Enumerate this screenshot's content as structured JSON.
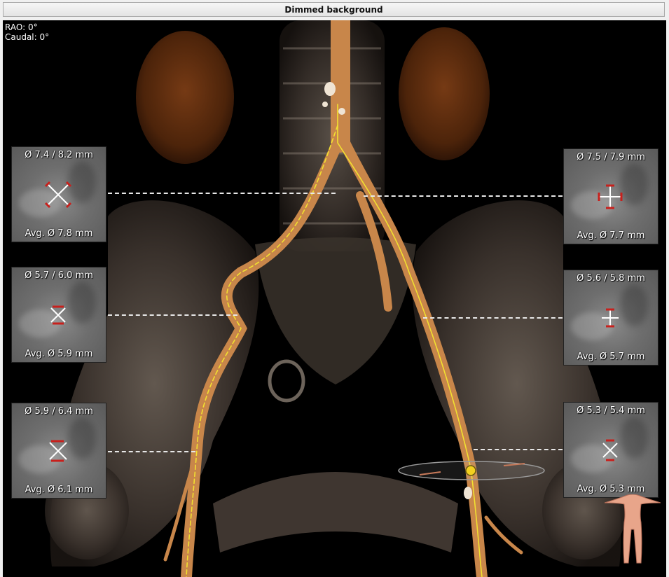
{
  "window": {
    "title": "Dimmed background"
  },
  "overlay": {
    "rao": "RAO: 0°",
    "caudal": "Caudal: 0°"
  },
  "panels": {
    "left": [
      {
        "top": "Ø 7.4 / 8.2 mm",
        "bottom": "Avg. Ø 7.8 mm"
      },
      {
        "top": "Ø 5.7 / 6.0 mm",
        "bottom": "Avg. Ø 5.9 mm"
      },
      {
        "top": "Ø 5.9 / 6.4 mm",
        "bottom": "Avg. Ø 6.1 mm"
      }
    ],
    "right": [
      {
        "top": "Ø 7.5 / 7.9 mm",
        "bottom": "Avg. Ø 7.7 mm"
      },
      {
        "top": "Ø 5.6 / 5.8 mm",
        "bottom": "Avg. Ø 5.7 mm"
      },
      {
        "top": "Ø 5.3 / 5.4 mm",
        "bottom": "Avg. Ø 5.3 mm"
      }
    ]
  },
  "colors": {
    "vessel": "#c8864a",
    "centerline": "#f2e030",
    "kidney": "#7a3a14",
    "marker_red": "#c8201c"
  },
  "icons": [
    "vessel-cross-section-icon",
    "orientation-figure-icon"
  ]
}
